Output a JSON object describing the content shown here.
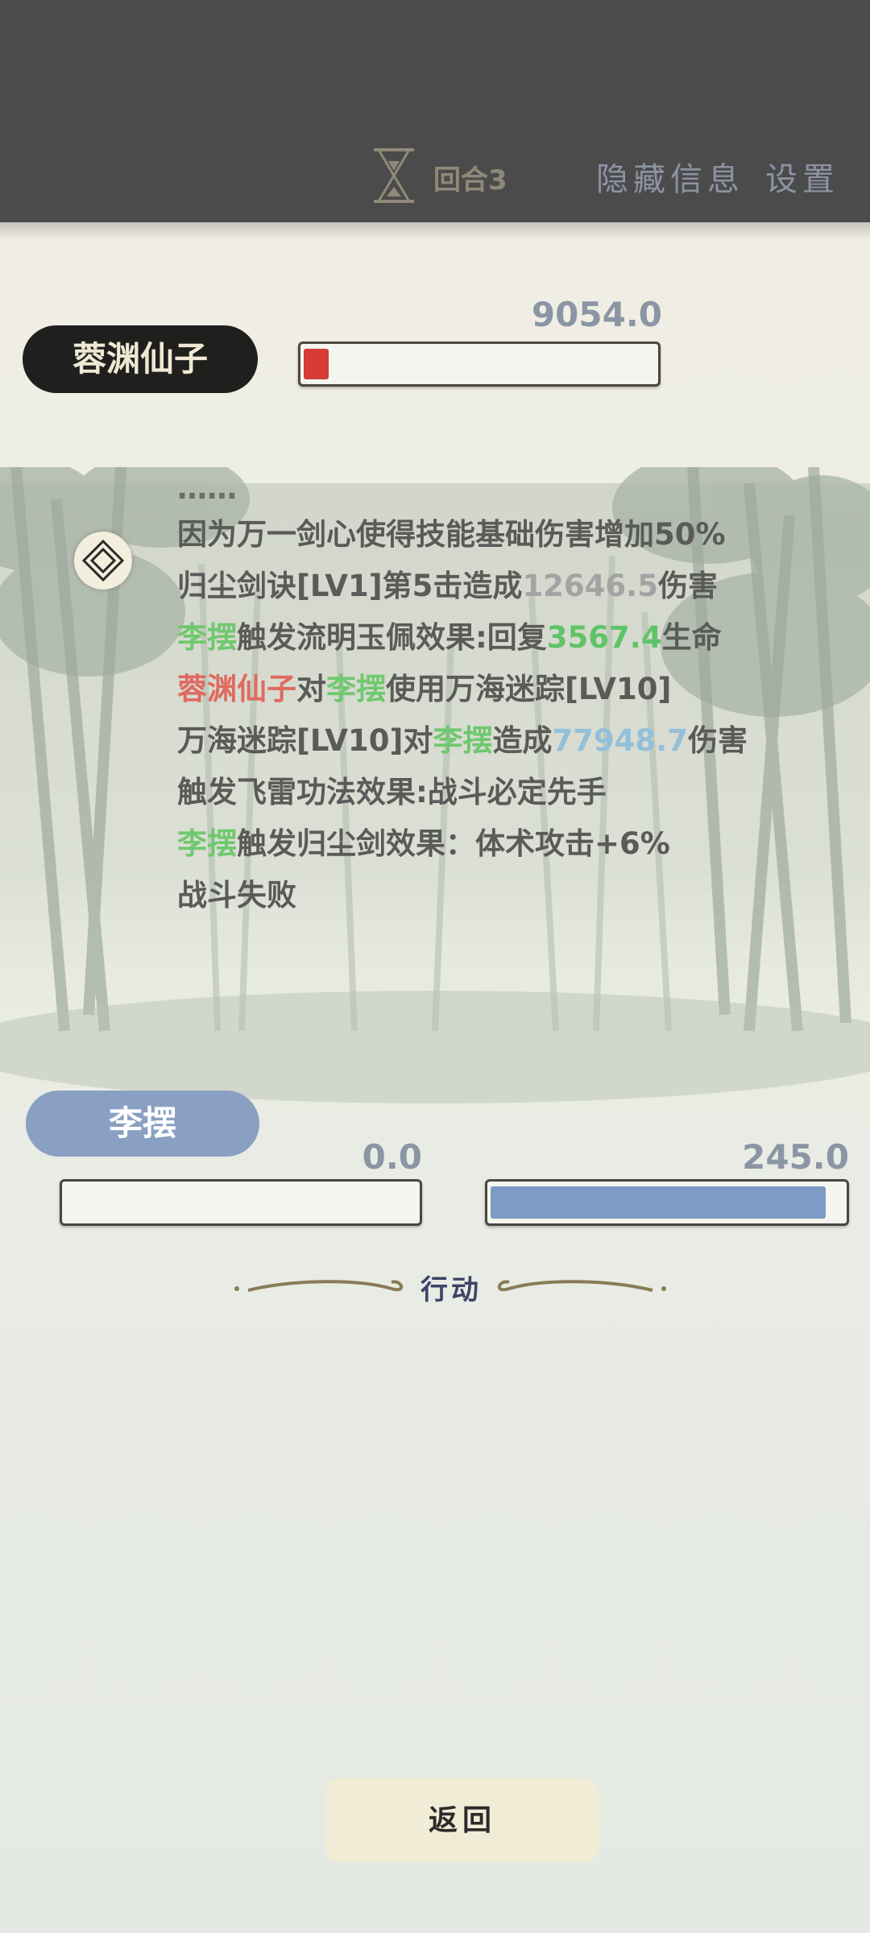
{
  "topbar": {
    "round_label": "回合3",
    "hide_info_label": "隐藏信息",
    "settings_label": "设置"
  },
  "enemy": {
    "name": "蓉渊仙子",
    "hp_value": "9054.0",
    "hp_fraction": 0.07,
    "hp_color": "#d63b36"
  },
  "battle_log": {
    "partial_line": "……",
    "lines": [
      [
        {
          "t": "因为万一剑心使得技能基础伤害增加50%",
          "c": ""
        }
      ],
      [
        {
          "t": "归尘剑诀[LV1]第5击造成",
          "c": ""
        },
        {
          "t": "12646.5",
          "c": "c-grey"
        },
        {
          "t": "伤害",
          "c": ""
        }
      ],
      [
        {
          "t": "李摆",
          "c": "c-green"
        },
        {
          "t": "触发流明玉佩效果:回复",
          "c": ""
        },
        {
          "t": "3567.4",
          "c": "c-green2"
        },
        {
          "t": "生命",
          "c": ""
        }
      ],
      [
        {
          "t": "蓉渊仙子",
          "c": "c-red"
        },
        {
          "t": "对",
          "c": ""
        },
        {
          "t": "李摆",
          "c": "c-green"
        },
        {
          "t": "使用万海迷踪[LV10]",
          "c": ""
        }
      ],
      [
        {
          "t": "万海迷踪[LV10]对",
          "c": ""
        },
        {
          "t": "李摆",
          "c": "c-green"
        },
        {
          "t": "造成",
          "c": ""
        },
        {
          "t": "77948.7",
          "c": "c-blue"
        },
        {
          "t": "伤害",
          "c": ""
        }
      ],
      [
        {
          "t": "触发飞雷功法效果:战斗必定先手",
          "c": ""
        }
      ],
      [
        {
          "t": "李摆",
          "c": "c-green"
        },
        {
          "t": "触发归尘剑效果：体术攻击+6%",
          "c": ""
        }
      ],
      [
        {
          "t": "战斗失败",
          "c": ""
        }
      ]
    ]
  },
  "player": {
    "name": "李摆",
    "hp_value": "0.0",
    "hp_fraction": 0.0,
    "mp_value": "245.0",
    "mp_fraction": 0.95,
    "mp_color": "#7d9bc4"
  },
  "action": {
    "label": "行动"
  },
  "footer": {
    "return_label": "返回"
  }
}
